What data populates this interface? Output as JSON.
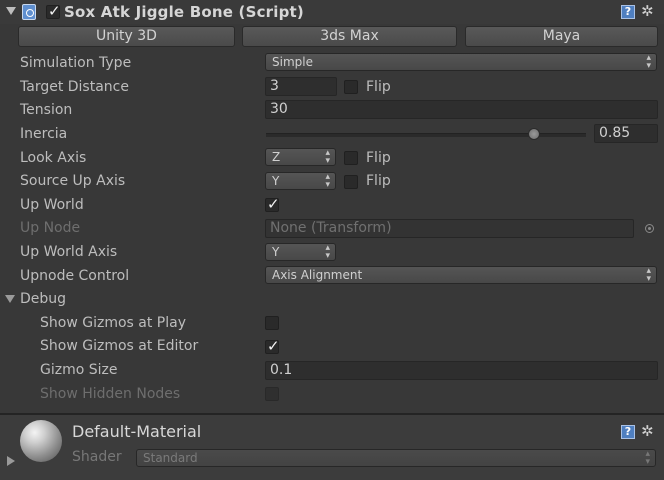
{
  "component": {
    "title": "Sox Atk Jiggle Bone (Script)",
    "enabled": true
  },
  "presets": [
    "Unity 3D",
    "3ds Max",
    "Maya"
  ],
  "fields": {
    "simulation_type": {
      "label": "Simulation Type",
      "value": "Simple"
    },
    "target_distance": {
      "label": "Target Distance",
      "value": "3",
      "flip_label": "Flip",
      "flip": false
    },
    "tension": {
      "label": "Tension",
      "value": "30"
    },
    "inercia": {
      "label": "Inercia",
      "value": "0.85",
      "slider_fraction": 0.85
    },
    "look_axis": {
      "label": "Look Axis",
      "value": "Z",
      "flip_label": "Flip",
      "flip": false
    },
    "source_up_axis": {
      "label": "Source Up Axis",
      "value": "Y",
      "flip_label": "Flip",
      "flip": false
    },
    "up_world": {
      "label": "Up World",
      "checked": true
    },
    "up_node": {
      "label": "Up Node",
      "value": "None (Transform)"
    },
    "up_world_axis": {
      "label": "Up World Axis",
      "value": "Y"
    },
    "upnode_control": {
      "label": "Upnode Control",
      "value": "Axis Alignment"
    }
  },
  "debug": {
    "label": "Debug",
    "expanded": true,
    "show_gizmos_play": {
      "label": "Show Gizmos at Play",
      "checked": false
    },
    "show_gizmos_editor": {
      "label": "Show Gizmos at Editor",
      "checked": true
    },
    "gizmo_size": {
      "label": "Gizmo Size",
      "value": "0.1"
    },
    "show_hidden_nodes": {
      "label": "Show Hidden Nodes",
      "checked": false
    }
  },
  "material": {
    "name": "Default-Material",
    "shader_label": "Shader",
    "shader_value": "Standard"
  },
  "icons": {
    "help": "help-icon",
    "settings": "gear-icon",
    "checkmark": "✓"
  }
}
